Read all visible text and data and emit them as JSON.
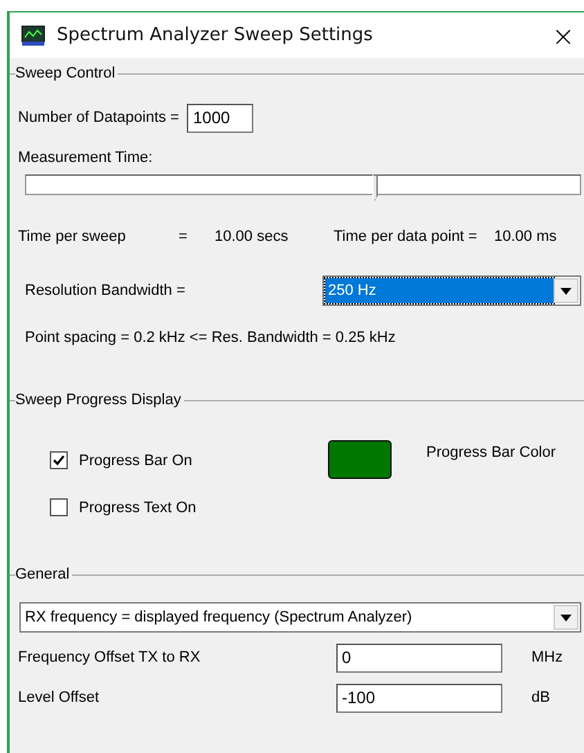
{
  "window": {
    "title": "Spectrum Analyzer Sweep Settings",
    "close": "×"
  },
  "sweep_control": {
    "title": "Sweep Control",
    "datapoints": {
      "label": "Number of Datapoints =",
      "value": "1000"
    },
    "measurement_time": {
      "label": "Measurement Time:",
      "level": 0.63
    },
    "time_per_sweep": {
      "label": "Time per sweep",
      "equals": "=",
      "value": "10.00 secs"
    },
    "time_per_point": {
      "label": "Time per data point =",
      "value": "10.00 ms"
    },
    "resolution": {
      "label": "Resolution Bandwidth =",
      "value": "250 Hz",
      "selected": true
    },
    "point_spacing": "Point spacing = 0.2 kHz <= Res. Bandwidth = 0.25 kHz"
  },
  "progress_display": {
    "title": "Sweep Progress Display",
    "checkboxes": [
      {
        "label": "Progress Bar On",
        "checked": true
      },
      {
        "label": "Progress Text On",
        "checked": false
      }
    ],
    "bar_color": {
      "label": "Progress Bar Color",
      "color": "#007800"
    }
  },
  "general": {
    "title": "General",
    "mode": {
      "value": "RX frequency = displayed frequency (Spectrum Analyzer)"
    },
    "fields": [
      {
        "label": "Frequency Offset TX to RX",
        "value": "0",
        "unit": "MHz"
      },
      {
        "label": "Level Offset",
        "value": "-100",
        "unit": "dB"
      }
    ]
  }
}
